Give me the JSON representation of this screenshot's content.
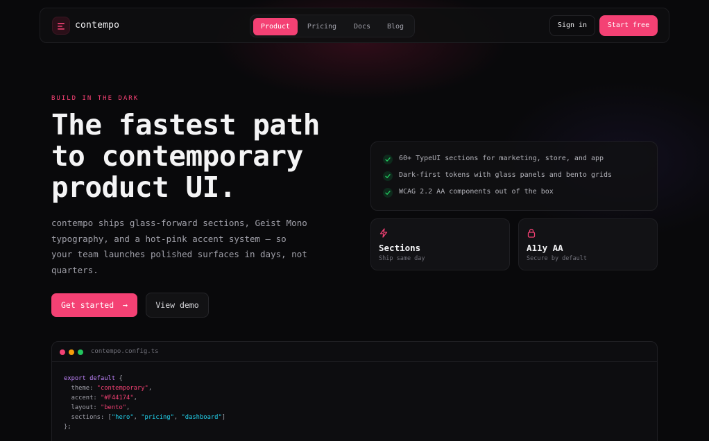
{
  "nav": {
    "brand": "contempo",
    "links": [
      {
        "label": "Product",
        "active": true
      },
      {
        "label": "Pricing",
        "active": false
      },
      {
        "label": "Docs",
        "active": false
      },
      {
        "label": "Blog",
        "active": false
      }
    ],
    "sign_in": "Sign in",
    "start_free": "Start free"
  },
  "hero": {
    "eyebrow": "BUILD IN THE DARK",
    "headline_line1": "The fastest path",
    "headline_line2": "to contemporary",
    "headline_line3": "product UI.",
    "subtext": "contempo ships glass-forward sections, Geist Mono typography, and a hot-pink accent system — so your team launches polished surfaces in days, not quarters.",
    "primary_button": "Get started",
    "primary_arrow": "→",
    "secondary_button": "View demo"
  },
  "features": [
    "60+ TypeUI sections for marketing, store, and app",
    "Dark-first tokens with glass panels and bento grids",
    "WCAG 2.2 AA components out of the box"
  ],
  "cards": [
    {
      "title": "Sections",
      "subtitle": "Ship same day",
      "icon": "bolt-icon"
    },
    {
      "title": "A11y AA",
      "subtitle": "Secure by default",
      "icon": "lock-icon"
    }
  ],
  "code": {
    "filename": "contempo.config.ts",
    "kw_export": "export default",
    "brace_open": " {",
    "theme_key": "  theme: ",
    "theme_val": "\"contemporary\"",
    "accent_key": "  accent: ",
    "accent_val": "\"#F44174\"",
    "layout_key": "  layout: ",
    "layout_val": "\"bento\"",
    "sections_key": "  sections: [",
    "sections_val1": "\"hero\"",
    "sections_val2": "\"pricing\"",
    "sections_val3": "\"dashboard\"",
    "sections_close": "]",
    "brace_close": "};",
    "comma": ",",
    "sep": ", "
  },
  "colors": {
    "accent": "#F44174",
    "background": "#09090B",
    "success": "#22C55E",
    "dot_red": "#F44174",
    "dot_orange": "#F59E0B",
    "dot_green": "#22C55E"
  }
}
